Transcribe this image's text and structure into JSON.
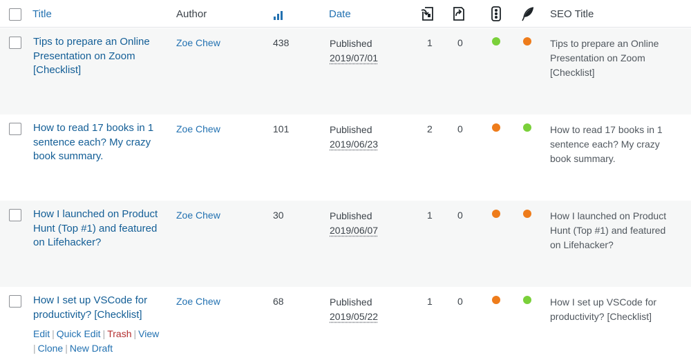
{
  "columns": {
    "title": "Title",
    "author": "Author",
    "date": "Date",
    "seo_title": "SEO Title",
    "views_icon": "bar-chart-icon",
    "incoming_links_icon": "incoming-links-icon",
    "outgoing_links_icon": "outgoing-links-icon",
    "seo_score_icon": "traffic-light-icon",
    "readability_icon": "feather-icon"
  },
  "colors": {
    "green": "#7ad03a",
    "orange": "#ee7c1b",
    "link": "#2271b1",
    "trash": "#b32d2e"
  },
  "rows": [
    {
      "title_lines": [
        "Tips to prepare an Online",
        "Presentation on Zoom",
        "[Checklist]"
      ],
      "author": "Zoe Chew",
      "views": "438",
      "status": "Published",
      "date": "2019/07/01",
      "links_in": "1",
      "links_out": "0",
      "seo_score": "green",
      "readability": "orange",
      "seo_title_lines": [
        "Tips to prepare an Online",
        "Presentation on Zoom",
        "[Checklist]"
      ]
    },
    {
      "title_lines": [
        "How to read 17 books in 1",
        "sentence each? My crazy",
        "book summary."
      ],
      "author": "Zoe Chew",
      "views": "101",
      "status": "Published",
      "date": "2019/06/23",
      "links_in": "2",
      "links_out": "0",
      "seo_score": "orange",
      "readability": "green",
      "seo_title_lines": [
        "How to read 17 books in 1",
        "sentence each? My crazy",
        "book summary."
      ]
    },
    {
      "title_lines": [
        "How I launched on Product",
        "Hunt (Top #1) and featured",
        "on Lifehacker?"
      ],
      "author": "Zoe Chew",
      "views": "30",
      "status": "Published",
      "date": "2019/06/07",
      "links_in": "1",
      "links_out": "0",
      "seo_score": "orange",
      "readability": "orange",
      "seo_title_lines": [
        "How I launched on Product",
        "Hunt (Top #1) and featured",
        "on Lifehacker?"
      ]
    },
    {
      "title_lines": [
        "How I set up VSCode for",
        "productivity? [Checklist]"
      ],
      "author": "Zoe Chew",
      "views": "68",
      "status": "Published",
      "date": "2019/05/22",
      "links_in": "1",
      "links_out": "0",
      "seo_score": "orange",
      "readability": "green",
      "seo_title_lines": [
        "How I set up VSCode for",
        "productivity? [Checklist]"
      ]
    }
  ],
  "row_actions": {
    "edit": "Edit",
    "quick_edit": "Quick Edit",
    "trash": "Trash",
    "view": "View",
    "clone": "Clone",
    "new_draft": "New Draft",
    "separator": "|"
  }
}
